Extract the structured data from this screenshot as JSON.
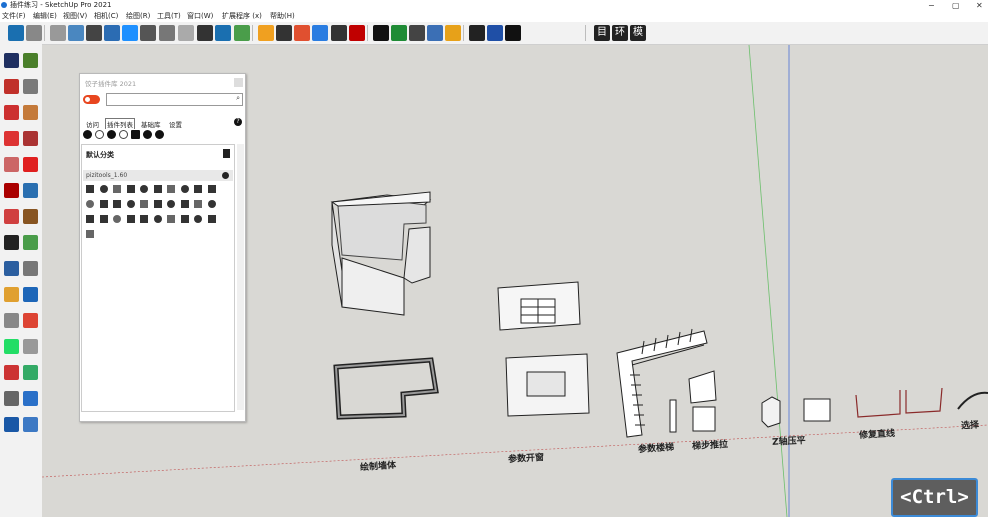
{
  "window": {
    "title": "插件练习 - SketchUp Pro 2021",
    "controls": [
      "−",
      "▢",
      "✕"
    ]
  },
  "menu": [
    "文件(F)",
    "编辑(E)",
    "视图(V)",
    "相机(C)",
    "绘图(R)",
    "工具(T)",
    "窗口(W)",
    "扩展程序 (x)",
    "帮助(H)"
  ],
  "toolbar": {
    "colors": [
      "#1a6fb0",
      "#888",
      "#999",
      "#4a87c0",
      "#444",
      "#2b6cb3",
      "#1e90ff",
      "#555",
      "#777",
      "#aaa",
      "#333",
      "#1a6fb0",
      "#4a9d4a",
      "#f0a020",
      "#333",
      "#e05030",
      "#2a7de1",
      "#333",
      "#c00000",
      "#111",
      "#1f8b35",
      "#444",
      "#3b6fb5",
      "#e7a119",
      "#222",
      "#1f4fa6",
      "#111"
    ],
    "text_buttons": [
      "目",
      "环",
      "模"
    ]
  },
  "left_tools": [
    "#1f2f60",
    "#4a7f2a",
    "#c0302a",
    "#7a7a7a",
    "#cc3030",
    "#c47a3a",
    "#d33",
    "#a33",
    "#c66",
    "#e02020",
    "#aa0000",
    "#2a6fb0",
    "#d04040",
    "#885522",
    "#222",
    "#4a9d4a",
    "#2c5fa0",
    "#777",
    "#e0a030",
    "#1d66b8",
    "#888",
    "#d43",
    "#2d6",
    "#999",
    "#c33",
    "#3a6",
    "#666",
    "#2a70c8",
    "#1a58a6",
    "#3d79c4"
  ],
  "panel": {
    "title": "饺子插件库 2021",
    "search_placeholder": "",
    "tabs": [
      "访问",
      "插件列表",
      "基础库",
      "设置"
    ],
    "active_tab": "插件列表",
    "category": "默认分类",
    "plugin_name": "pizitools_1.60",
    "plugin_icon_count": 31
  },
  "scene": {
    "labels": [
      "绘制墙体",
      "参数开窗",
      "参数楼梯",
      "梯步推拉",
      "Z轴压平",
      "修复直线",
      "选择"
    ]
  },
  "overlay": {
    "key_hint": "<Ctrl>"
  }
}
